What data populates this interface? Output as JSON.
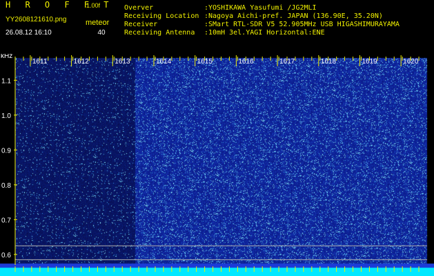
{
  "header": {
    "app_title": "H R O F F T",
    "version": "1.00f",
    "filename": "YY2608121610.png",
    "timestamp": "26.08.12 16:10",
    "meteor_label": "meteor",
    "meteor_count": "40"
  },
  "info": [
    {
      "key": "Overver",
      "value": ":YOSHIKAWA Yasufumi /JG2MLI"
    },
    {
      "key": "Receiving Location",
      "value": ":Nagoya Aichi-pref. JAPAN (136.90E, 35.20N)"
    },
    {
      "key": "Receiver",
      "value": ":SMart RTL-SDR V5 52.905MHz USB HIGASHIMURAYAMA"
    },
    {
      "key": "Receiving Antenna",
      "value": ":10mH 3el.YAGI Horizontal:ENE"
    }
  ],
  "chart_data": {
    "type": "heatmap",
    "y_unit_label": "kHz",
    "y_ticks": [
      "1.1",
      "1.0",
      "0.9",
      "0.8",
      "0.7",
      "0.6"
    ],
    "y_values": [
      1.1,
      1.0,
      0.9,
      0.8,
      0.7,
      0.6
    ],
    "x_ticks": [
      "1611",
      "1612",
      "1613",
      "1614",
      "1615",
      "1616",
      "1617",
      "1618",
      "1619",
      "1620"
    ],
    "x_values": [
      1611,
      1612,
      1613,
      1614,
      1615,
      1616,
      1617,
      1618,
      1619,
      1620
    ],
    "x_start": 1610.6,
    "x_end": 1620.6,
    "y_top": 1.16,
    "y_bottom": 0.57,
    "dark_band_minutes": [
      1610.6,
      1613.5
    ],
    "colors": {
      "background": "#000000",
      "field_blue": "#0c1f9c",
      "dark_blue": "#07125c",
      "speckle": "#48c8ff",
      "tick_yellow": "#f2f200",
      "baseline_cyan": "#00e8ff",
      "ref_line": "#b0b0b0"
    }
  }
}
